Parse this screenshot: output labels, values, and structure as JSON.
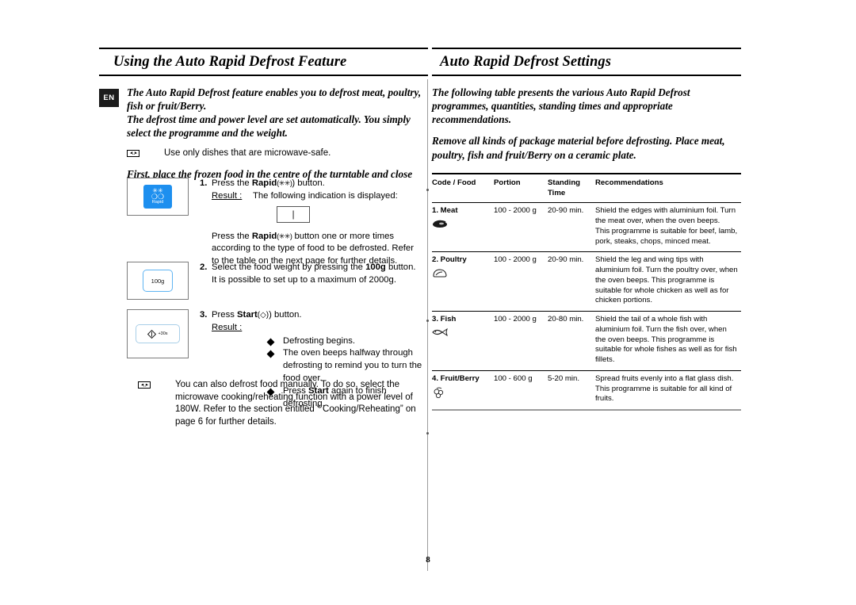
{
  "language_tab": "EN",
  "page_number": "8",
  "left": {
    "heading": "Using the Auto Rapid Defrost Feature",
    "intro_1": "The Auto Rapid Defrost feature enables you to defrost  meat, poultry, fish or fruit/Berry.",
    "intro_2": "The defrost time and power level are set automatically. You simply select the programme and the weight.",
    "note_1": "Use only dishes that are microwave-safe.",
    "intro_3": "First, place the frozen food in the centre of the turntable and close the door.",
    "steps": [
      {
        "num": "1.",
        "button_icon": "rapid-button-icon",
        "button_label": "Rapid",
        "line_1_pre": "Press the ",
        "line_1_bold": "Rapid",
        "line_1_post": ") button.",
        "result_label": "Result :",
        "result_text": "The following indication is displayed:",
        "display_value": "|",
        "followup": "button one or more times according to the type of food to be defrosted. Refer to the table on the next page for further details.",
        "followup_pre": "Press the ",
        "followup_bold": "Rapid"
      },
      {
        "num": "2.",
        "button_label": "100g",
        "line_1_pre": "Select the food weight by pressing the ",
        "line_1_bold": "100g",
        "line_1_post": " button.",
        "line_2": "It is possible to set up to a maximum of 2000g."
      },
      {
        "num": "3.",
        "button_label": "+30s",
        "line_1_pre": "Press ",
        "line_1_bold": "Start",
        "line_1_post": ") button.",
        "result_label": "Result :",
        "bullets": [
          "Defrosting begins.",
          "The oven beeps halfway through defrosting to remind you to turn the food over.",
          "Press Start again to finish defrosting."
        ],
        "bullet_3_pre": "Press ",
        "bullet_3_bold": "Start",
        "bullet_3_post": " again to finish defrosting."
      }
    ],
    "note_2": "You can also defrost food manually. To do so, select the microwave cooking/reheating function with a power level of 180W. Refer to the section entitled “ Cooking/Reheating” on page 6  for further details."
  },
  "right": {
    "heading": "Auto Rapid Defrost Settings",
    "intro_1": "The following table presents the various Auto Rapid Defrost programmes, quantities, standing times and appropriate recommendations.",
    "intro_2": "Remove all kinds of package material before defrosting. Place meat, poultry, fish and fruit/Berry on a ceramic plate.",
    "table": {
      "columns": [
        "Code / Food",
        "Portion",
        "Standing Time",
        "Recommendations"
      ],
      "column_time_line1": "Standing",
      "column_time_line2": "Time",
      "rows": [
        {
          "food": "1. Meat",
          "icon": "meat-icon",
          "portion": "100 - 2000 g",
          "standing_time": "20-90 min.",
          "recommendations": "Shield the edges with aluminium foil. Turn the meat over, when the oven beeps.\nThis programme is suitable for beef, lamb, pork, steaks, chops, minced meat."
        },
        {
          "food": "2. Poultry",
          "icon": "poultry-icon",
          "portion": "100 - 2000 g",
          "standing_time": "20-90 min.",
          "recommendations": "Shield the leg and wing tips with aluminium foil. Turn the poultry over, when the oven beeps. This programme is suitable for whole chicken as well as for chicken portions."
        },
        {
          "food": "3. Fish",
          "icon": "fish-icon",
          "portion": "100 - 2000 g",
          "standing_time": "20-80 min.",
          "recommendations": "Shield the tail of a whole fish with aluminium foil. Turn the fish over, when the oven beeps. This programme is suitable for whole fishes as well as for fish fillets."
        },
        {
          "food": "4. Fruit/Berry",
          "icon": "berry-icon",
          "portion": "100 - 600 g",
          "standing_time": "5-20 min.",
          "recommendations": "Spread fruits evenly into a flat glass dish. This programme is suitable for all kind of fruits."
        }
      ]
    }
  }
}
